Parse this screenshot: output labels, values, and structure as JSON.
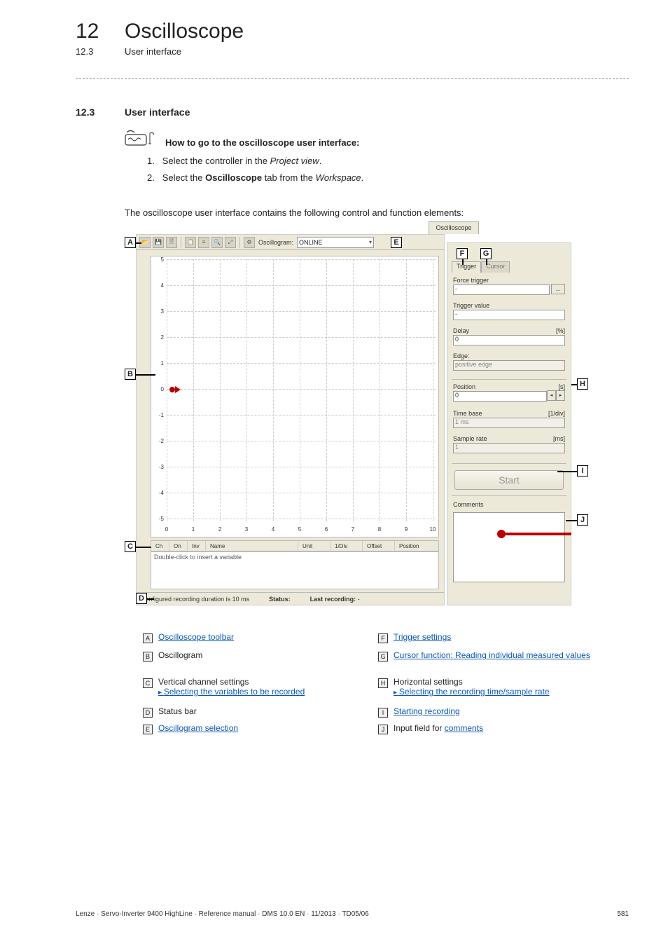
{
  "chapter": {
    "num": "12",
    "title": "Oscilloscope"
  },
  "sub": {
    "num": "12.3",
    "title": "User interface"
  },
  "section": {
    "num": "12.3",
    "title": "User interface"
  },
  "howto": {
    "title": "How to go to the oscilloscope user interface:",
    "step1_num": "1.",
    "step1_a": "Select the controller in the ",
    "step1_i": "Project view",
    "step1_b": ".",
    "step2_num": "2.",
    "step2_a": "Select the ",
    "step2_bold": "Oscilloscope",
    "step2_b": " tab from the ",
    "step2_i": "Workspace",
    "step2_c": "."
  },
  "intro": "The oscilloscope user interface contains the following control and function elements:",
  "shot": {
    "tab": "Oscilloscope",
    "toolbar": {
      "oscillogram_label": "Oscillogram:",
      "oscillogram_value": "ONLINE"
    },
    "plot": {
      "y_ticks": [
        "5",
        "4",
        "3",
        "2",
        "1",
        "0",
        "-1",
        "-2",
        "-3",
        "-4",
        "-5"
      ],
      "x_ticks": [
        "0",
        "1",
        "2",
        "3",
        "4",
        "5",
        "6",
        "7",
        "8",
        "9",
        "10"
      ]
    },
    "cols": {
      "c1": "Ch",
      "c2": "On",
      "c3": "Inv",
      "c4": "Name",
      "c5": "Unit",
      "c6": "1/Div",
      "c7": "Offset",
      "c8": "Position"
    },
    "var_hint": "Double-click to insert a variable",
    "status": {
      "cfg": "Configured recording duration is 10 ms",
      "status_lbl": "Status:",
      "last_lbl": "Last recording:",
      "last_val": "-"
    },
    "side": {
      "tab_trigger": "Trigger",
      "tab_cursor": "Cursor",
      "force_trigger": "Force trigger",
      "force_val": "-",
      "trigger_value": "Trigger value",
      "trigger_val_v": "-",
      "delay": "Delay",
      "delay_u": "[%]",
      "delay_v": "0",
      "edge": "Edge:",
      "edge_v": "positive edge",
      "position": "Position",
      "position_u": "[s]",
      "position_v": "0",
      "timebase": "Time base",
      "timebase_u": "[1/div]",
      "timebase_v": "1 ms",
      "sample": "Sample rate",
      "sample_u": "[ms]",
      "sample_v": "1",
      "start": "Start",
      "comments": "Comments"
    },
    "ellipsis": "..."
  },
  "callouts": {
    "A": "A",
    "B": "B",
    "C": "C",
    "D": "D",
    "E": "E",
    "F": "F",
    "G": "G",
    "H": "H",
    "I": "I",
    "J": "J"
  },
  "legend": {
    "A": "Oscilloscope toolbar",
    "B": "Oscillogram",
    "C": "Vertical channel settings",
    "C_sub": "Selecting the variables to be recorded",
    "D": "Status bar",
    "E": "Oscillogram selection",
    "F": "Trigger settings",
    "G": "Cursor function: Reading individual measured values",
    "H": "Horizontal settings",
    "H_sub": "Selecting the recording time/sample rate",
    "I": "Starting recording",
    "J_a": "Input field for ",
    "J_link": "comments"
  },
  "footer": {
    "left": "Lenze · Servo-Inverter 9400 HighLine · Reference manual · DMS 10.0 EN · 11/2013 · TD05/06",
    "right": "581"
  }
}
